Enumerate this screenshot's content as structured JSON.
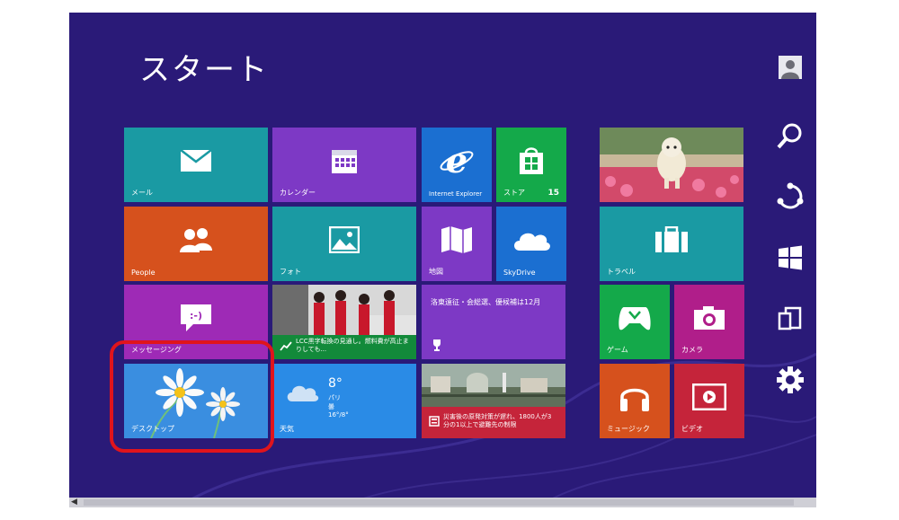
{
  "start": {
    "title": "スタート"
  },
  "tiles": {
    "mail": {
      "label": "メール"
    },
    "calendar": {
      "label": "カレンダー"
    },
    "ie": {
      "label": "Internet Explorer"
    },
    "store": {
      "label": "ストア",
      "badge": "15"
    },
    "people": {
      "label": "People"
    },
    "photos": {
      "label": "フォト"
    },
    "maps": {
      "label": "地図"
    },
    "skydrive": {
      "label": "SkyDrive"
    },
    "travel": {
      "label": "トラベル"
    },
    "messaging": {
      "label": "メッセージング"
    },
    "finance": {
      "headline": "LCC黒字転換の見通し。燃料費が高止まりしても..."
    },
    "sports": {
      "headline": "洛東遠征・会総選、優候補は12月"
    },
    "games": {
      "label": "ゲーム"
    },
    "camera": {
      "label": "カメラ"
    },
    "desktop": {
      "label": "デスクトップ"
    },
    "weather": {
      "temp": "8°",
      "location": "パリ",
      "condition": "曇",
      "range": "16°/8°",
      "label": "天気"
    },
    "news": {
      "headline": "災害後の原発対策が遅れ、1800人が3分の1以上で避難先の制限"
    },
    "music": {
      "label": "ミュージック"
    },
    "video": {
      "label": "ビデオ"
    }
  },
  "colors": {
    "background": "#2a1a78",
    "highlight": "#e0141c"
  }
}
